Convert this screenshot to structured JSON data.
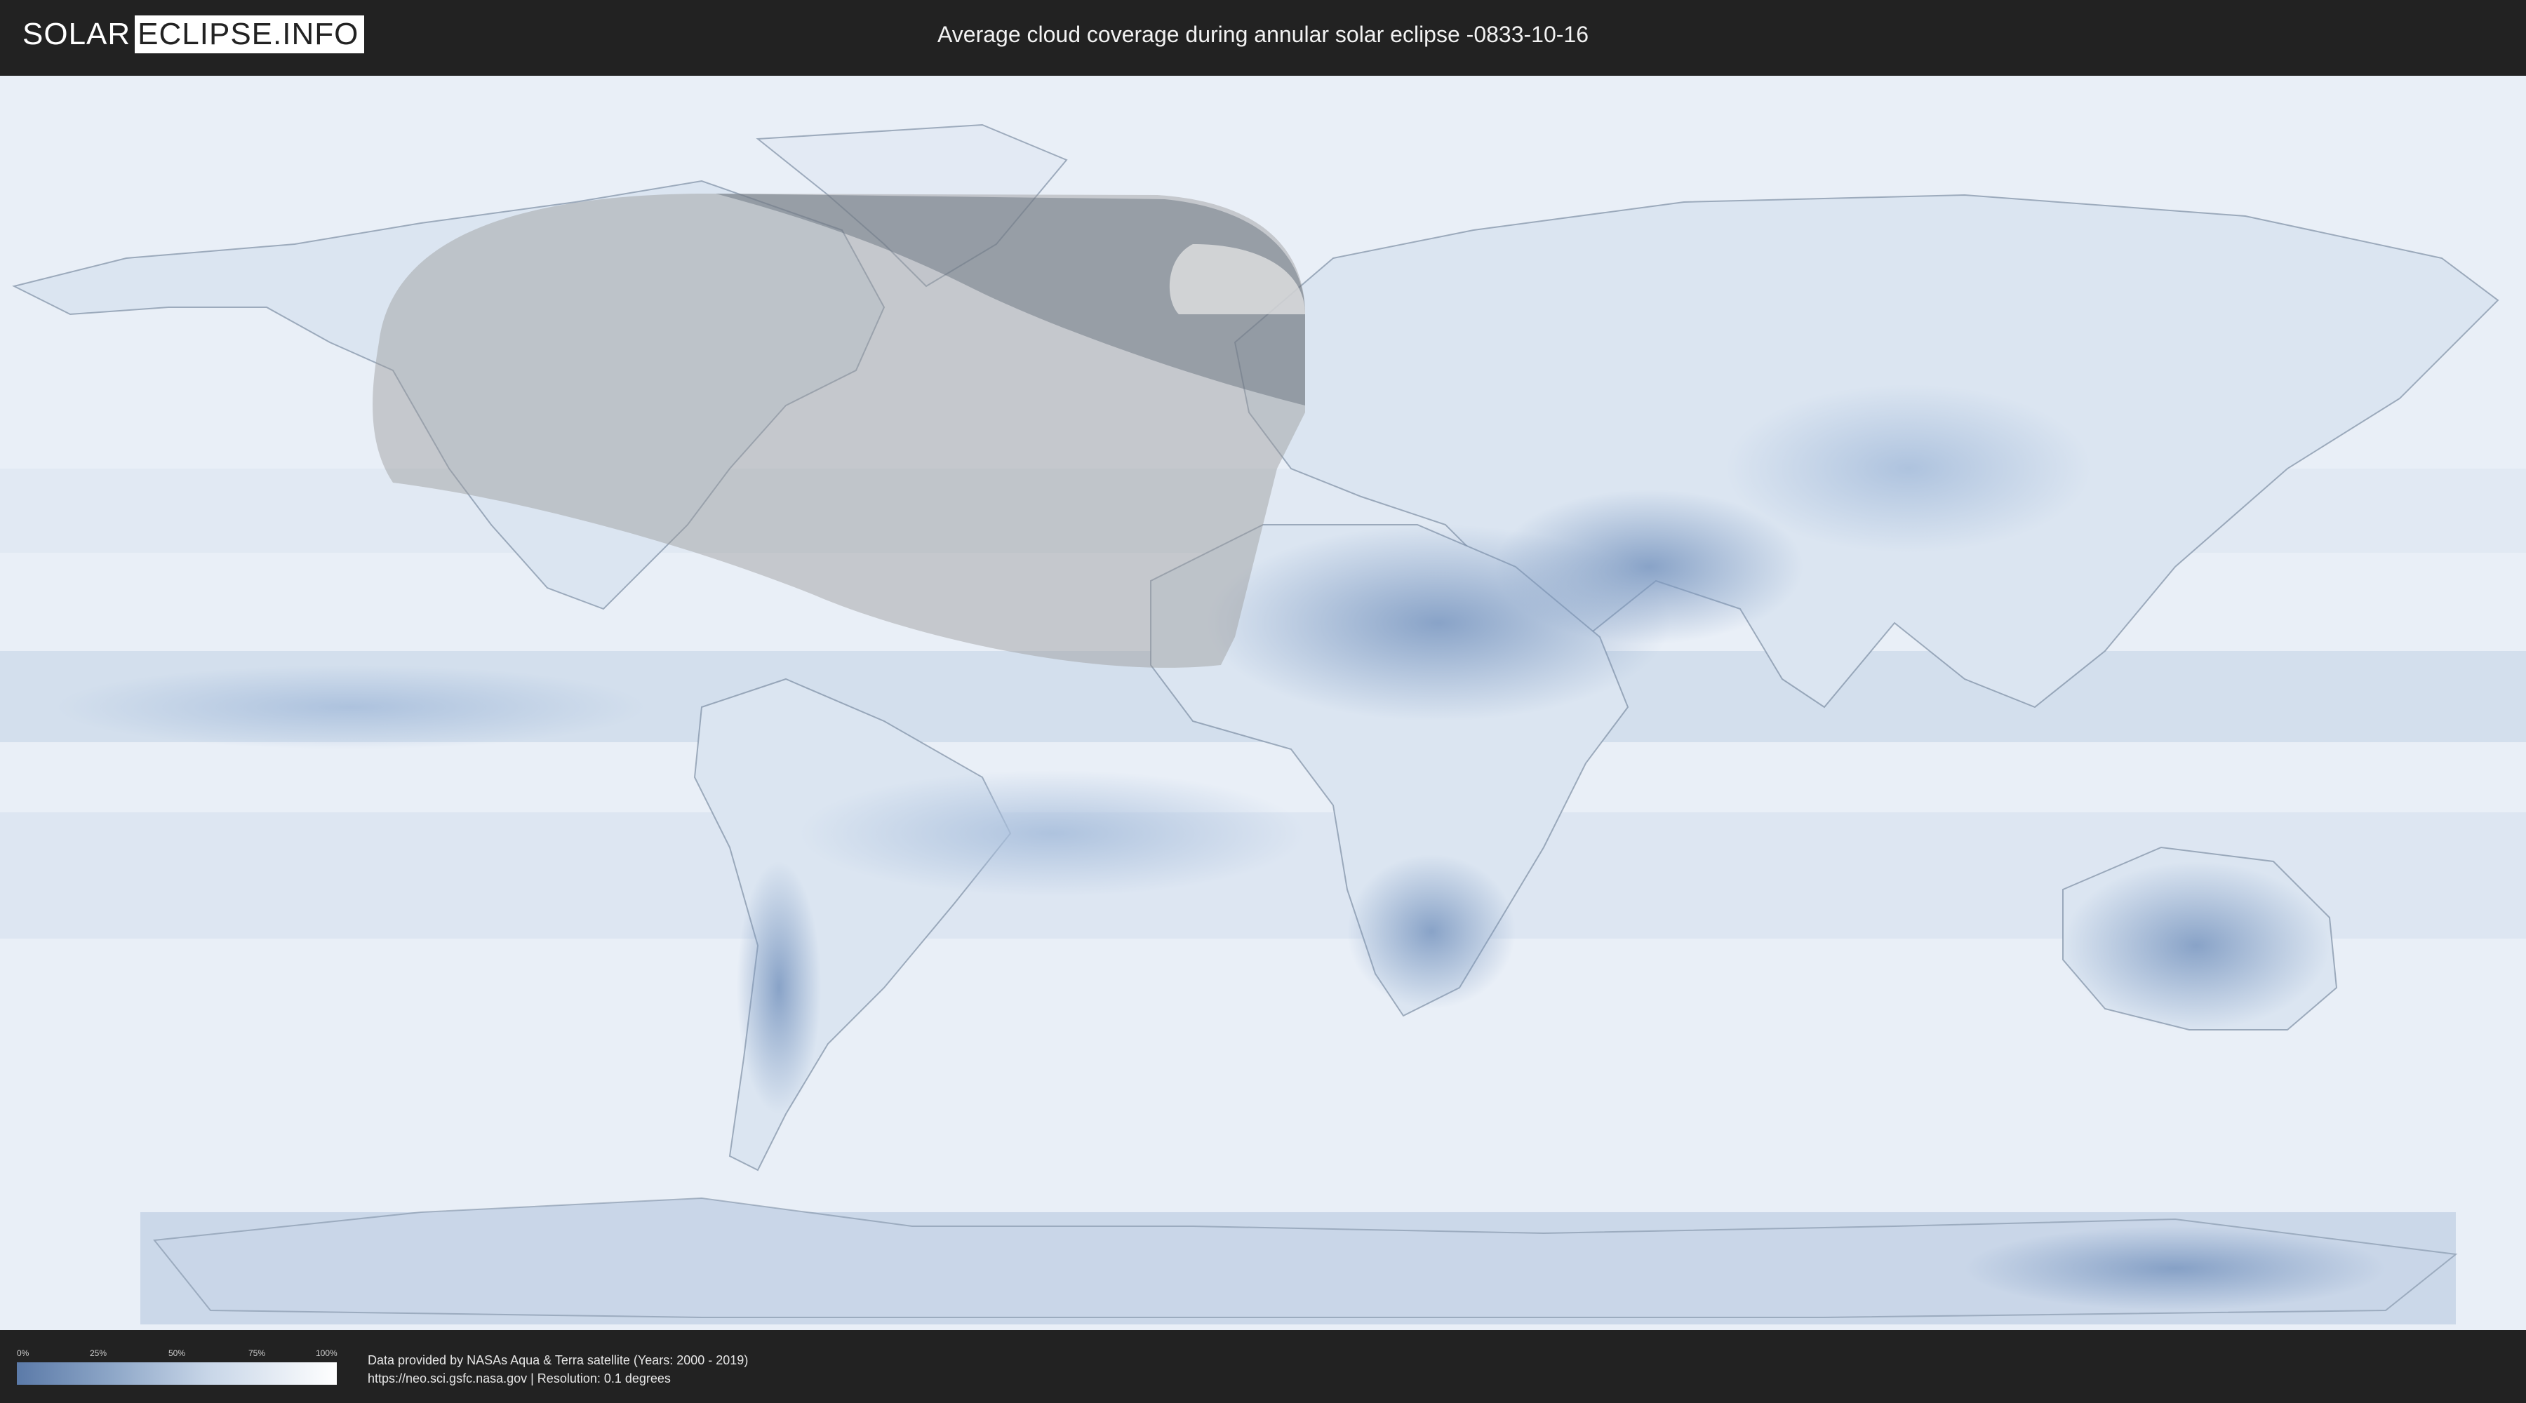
{
  "header": {
    "logo_left": "SOLAR",
    "logo_right": "ECLIPSE.INFO",
    "title": "Average cloud coverage during annular solar eclipse -0833-10-16"
  },
  "map": {
    "colors": {
      "ocean_cloud_high": "#eef3f9",
      "cloud_low": "#6f8db8",
      "cloud_mid": "#a9bfdc",
      "border_line": "#6d7f96",
      "eclipse_overlay": "#9a9a9a",
      "path_dark": "#5f6a78",
      "path_light": "#e9e9e9"
    }
  },
  "legend": {
    "ticks": [
      "0%",
      "25%",
      "50%",
      "75%",
      "100%"
    ],
    "gradient_colors": [
      "#5b7aa8",
      "#8ea7c8",
      "#c8d6e8",
      "#ffffff"
    ]
  },
  "footer": {
    "credit_line1": "Data provided by NASAs Aqua & Terra satellite (Years: 2000 - 2019)",
    "credit_line2": "https://neo.sci.gsfc.nasa.gov | Resolution: 0.1 degrees"
  }
}
